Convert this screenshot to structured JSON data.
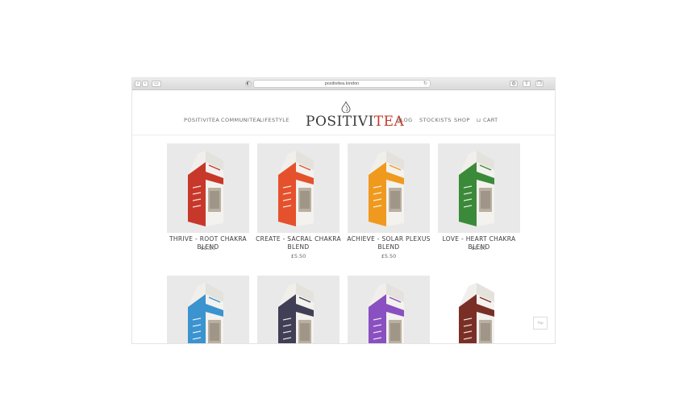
{
  "browser": {
    "url": "positivitea.london"
  },
  "nav": {
    "left": [
      "POSITIVITEA",
      "COMMUNITEA",
      "LIFESTYLE"
    ],
    "right": [
      "BLOG",
      "STOCKISTS",
      "SHOP"
    ],
    "cart": "CART"
  },
  "logo": {
    "main": "POSITIVI",
    "accent": "TEA"
  },
  "products": [
    {
      "title": "THRIVE - ROOT CHAKRA BLEND",
      "price": "£5.50",
      "color": "#c8382a",
      "label": "THRIVE"
    },
    {
      "title": "CREATE - SACRAL CHAKRA BLEND",
      "price": "£5.50",
      "color": "#e5512c",
      "label": "CREATE"
    },
    {
      "title": "ACHIEVE - SOLAR PLEXUS BLEND",
      "price": "£5.50",
      "color": "#ef9a1e",
      "label": "ACHIEVE"
    },
    {
      "title": "LOVE - HEART CHAKRA BLEND",
      "price": "£5.50",
      "color": "#3b8a3a",
      "label": "LOVE"
    },
    {
      "title": "",
      "price": "",
      "color": "#3b93cf",
      "label": "INSPIRE"
    },
    {
      "title": "",
      "price": "",
      "color": "#403f55",
      "label": "IMAGINE"
    },
    {
      "title": "",
      "price": "",
      "color": "#8a4fc0",
      "label": "CONNECT"
    },
    {
      "title": "",
      "price": "",
      "color": "#7a2f26",
      "label": ""
    }
  ],
  "top_button": "Top"
}
